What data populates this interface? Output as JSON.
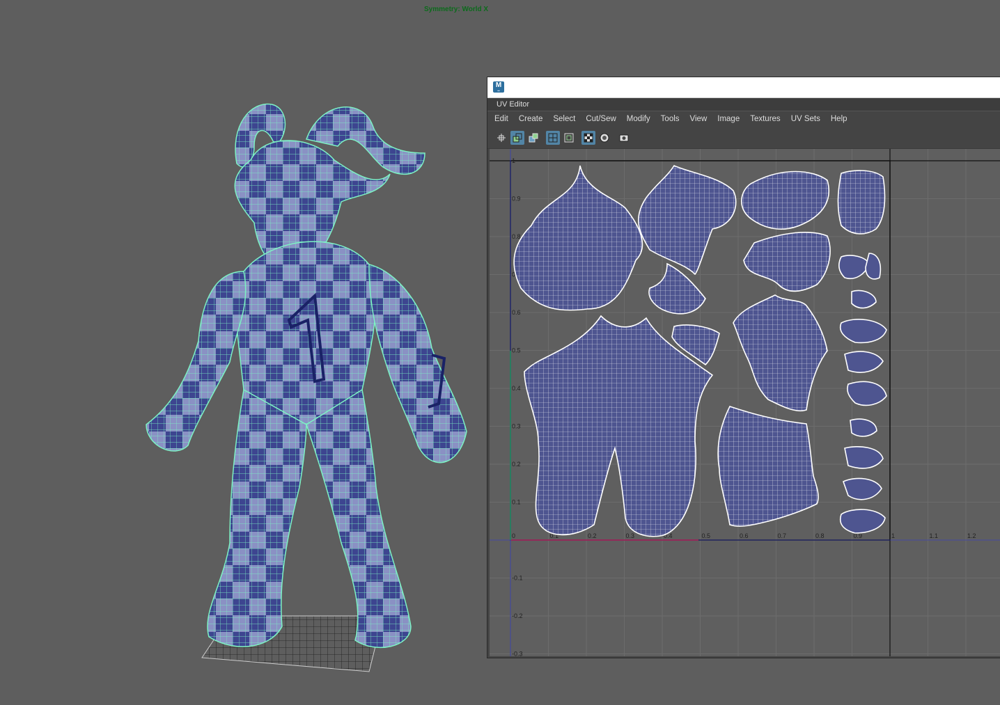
{
  "viewport": {
    "symmetry_label": "Symmetry: World X",
    "colors": {
      "wire": "#7df2c4",
      "check_light": "#8a91c4",
      "check_dark": "#3d4590",
      "background": "#5e5e5e"
    }
  },
  "uv_editor": {
    "title": "UV Editor",
    "app_icon": "maya-app-icon",
    "menu": [
      "Edit",
      "Create",
      "Select",
      "Cut/Sew",
      "Modify",
      "Tools",
      "View",
      "Image",
      "Textures",
      "UV Sets",
      "Help"
    ],
    "toolbar_icons": [
      {
        "name": "uv-toolkit-icon",
        "active": false
      },
      {
        "name": "uv-shell-icon",
        "active": true
      },
      {
        "name": "uv-shaded-icon",
        "active": false
      },
      {
        "name": "grid-display-icon",
        "active": true
      },
      {
        "name": "texture-borders-icon",
        "active": false
      },
      {
        "name": "checker-map-icon",
        "active": true
      },
      {
        "name": "distortion-icon",
        "active": false
      },
      {
        "name": "snapshot-icon",
        "active": false
      }
    ],
    "x_ticks": [
      "0",
      "0.1",
      "0.2",
      "0.3",
      "0.4",
      "0.5",
      "0.6",
      "0.7",
      "0.8",
      "0.9",
      "1",
      "1.1",
      "1.2"
    ],
    "y_ticks": [
      "1",
      "0.9",
      "0.8",
      "0.7",
      "0.6",
      "0.5",
      "0.4",
      "0.3",
      "0.2",
      "0.1",
      "-0.1",
      "-0.2",
      "-0.3"
    ],
    "colors": {
      "shell_fill": "#4e5590",
      "shell_wire": "#ffffff",
      "u_axis": "#c0262b",
      "v_axis": "#2aa32a",
      "grid_bg": "#5f5f5f"
    }
  }
}
